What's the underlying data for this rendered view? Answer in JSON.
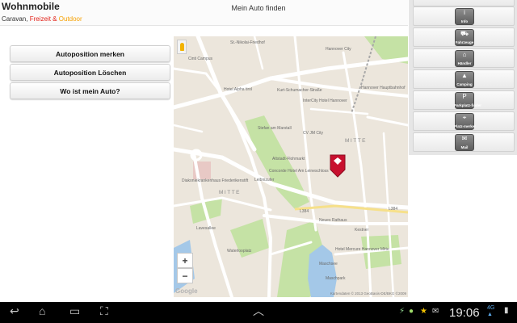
{
  "header": {
    "brand_title": "Wohnmobile",
    "brand_sub_1": "Caravan,",
    "brand_sub_2": "Freizeit &",
    "brand_sub_3": "Outdoor",
    "page_title": "Mein Auto finden"
  },
  "buttons": {
    "save": "Autoposition merken",
    "delete": "Autoposition Löschen",
    "where": "Wo ist mein Auto?"
  },
  "map": {
    "labels": {
      "st_nikolai": "St.-Nikolai-Friedhof",
      "cinti_campus": "Cinti Campus",
      "hannover_city": "Hannover City",
      "hotel_alpha": "Hotel Alpha tirol",
      "kurt_schumacher": "Kurt-Schumacher-Straße",
      "intercity": "InterCity Hotel Hannover",
      "hbf": "Hannover Hauptbahnhof",
      "cv_jm": "CV JM City",
      "stefan": "Stefan am Marstall",
      "mitte1": "MITTE",
      "altstadt": "Altstadt-Flohmarkt",
      "concorde": "Concorde Hotel Am Leineschloss",
      "diakonie": "Diakoniekrankenhaus Friederikenstift",
      "mitte2": "MITTE",
      "neues_rathaus": "Neues Rathaus",
      "kestner": "Kestner",
      "waterloo": "Waterlooplatz",
      "maschsee": "Maschsee",
      "maschpark": "Maschpark",
      "mercure": "Hotel Mercure Hannover Mitte",
      "lavesallee": "Lavesallee",
      "l384a": "L384",
      "l384b": "L384",
      "leibnizufer": "Leibnizufer"
    },
    "zoom_in": "+",
    "zoom_out": "−",
    "google": "Google",
    "attribution": "Kartendaten © 2013 GeoBasis-DE/BKG ©2009"
  },
  "menu": {
    "items": [
      {
        "label": "Info",
        "glyph": "i",
        "icon": "info-icon"
      },
      {
        "label": "Fahrzeuge",
        "glyph": "⛟",
        "icon": "vehicles-icon"
      },
      {
        "label": "Händler",
        "glyph": "⌂",
        "icon": "dealer-icon"
      },
      {
        "label": "Camping",
        "glyph": "▲",
        "icon": "camping-icon"
      },
      {
        "label": "Parkplatz-finder",
        "glyph": "P",
        "icon": "parking-icon"
      },
      {
        "label": "Platz-merker",
        "glyph": "⌖",
        "icon": "bookmark-icon"
      },
      {
        "label": "Mail",
        "glyph": "✉",
        "icon": "mail-icon"
      }
    ]
  },
  "statusbar": {
    "time": "19:06",
    "network": "4G"
  },
  "colors": {
    "brand_red": "#e2231a",
    "brand_orange": "#f6a000",
    "marker_red": "#c8102e",
    "water": "#a4c8e8",
    "park": "#c5e2a5"
  }
}
